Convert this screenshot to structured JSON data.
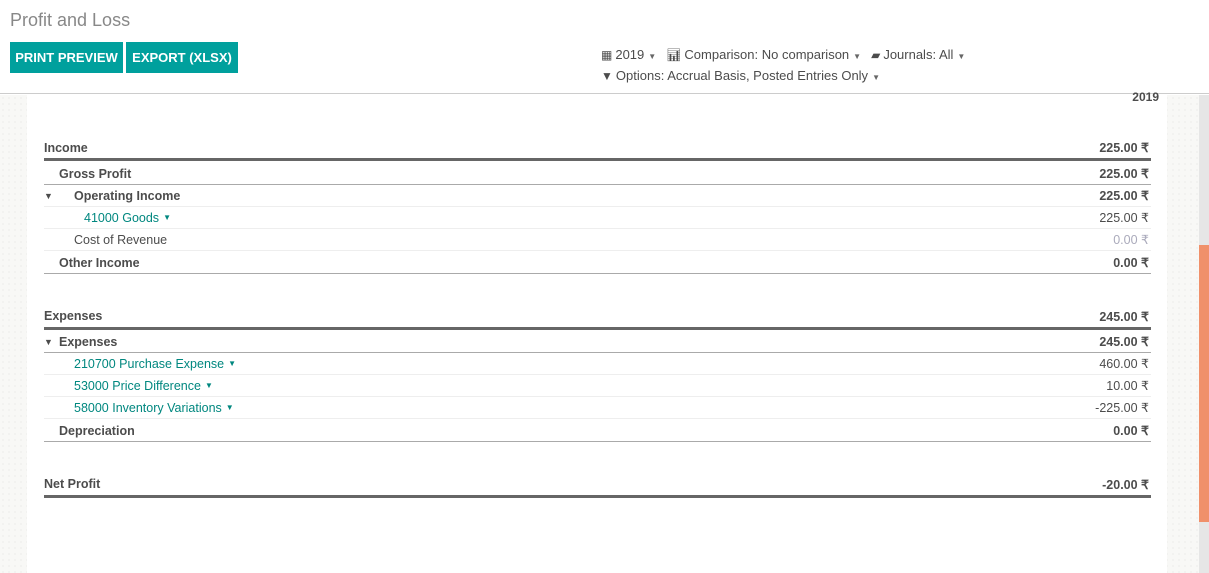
{
  "header": {
    "title": "Profit and Loss",
    "print_preview": "PRINT PREVIEW",
    "export": "EXPORT (XLSX)"
  },
  "filters": {
    "date": "2019",
    "comparison": "Comparison: No comparison",
    "journals": "Journals: All",
    "options": "Options: Accrual Basis, Posted Entries Only"
  },
  "report": {
    "column": "2019",
    "rows": [
      {
        "label": "Income",
        "amount": "225.00 ₹"
      },
      {
        "label": "Gross Profit",
        "amount": "225.00 ₹"
      },
      {
        "label": "Operating Income",
        "amount": "225.00 ₹"
      },
      {
        "label": "41000 Goods",
        "amount": "225.00 ₹"
      },
      {
        "label": "Cost of Revenue",
        "amount": "0.00 ₹"
      },
      {
        "label": "Other Income",
        "amount": "0.00 ₹"
      },
      {
        "label": "Expenses",
        "amount": "245.00 ₹"
      },
      {
        "label": "Expenses",
        "amount": "245.00 ₹"
      },
      {
        "label": "210700 Purchase Expense",
        "amount": "460.00 ₹"
      },
      {
        "label": "53000 Price Difference",
        "amount": "10.00 ₹"
      },
      {
        "label": "58000 Inventory Variations",
        "amount": "-225.00 ₹"
      },
      {
        "label": "Depreciation",
        "amount": "0.00 ₹"
      },
      {
        "label": "Net Profit",
        "amount": "-20.00 ₹"
      }
    ]
  },
  "colors": {
    "accent": "#00a09d",
    "link": "#00877f",
    "scrollbar": "#f0906a"
  }
}
